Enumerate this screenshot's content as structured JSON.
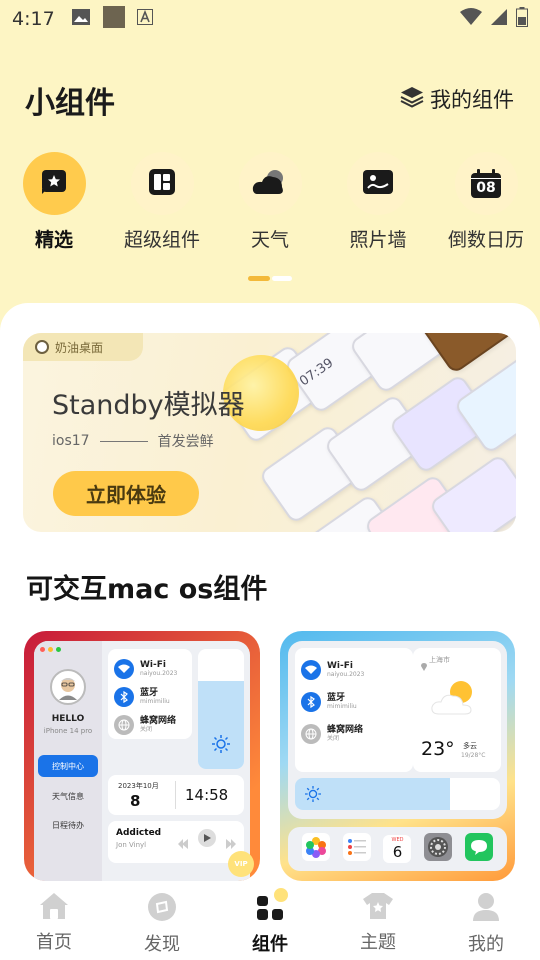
{
  "status_bar": {
    "time": "4:17"
  },
  "header": {
    "title": "小组件",
    "my_widgets_label": "我的组件"
  },
  "categories": [
    {
      "label": "精选",
      "icon": "star-icon",
      "active": true
    },
    {
      "label": "超级组件",
      "icon": "grid-icon",
      "active": false
    },
    {
      "label": "天气",
      "icon": "cloud-icon",
      "active": false
    },
    {
      "label": "照片墙",
      "icon": "photo-icon",
      "active": false
    },
    {
      "label": "倒数日历",
      "icon": "calendar-icon",
      "calendar_day": "08",
      "active": false
    }
  ],
  "banner": {
    "tag": "奶油桌面",
    "title": "Standby模拟器",
    "subtitle_left": "ios17",
    "subtitle_right": "首发尝鲜",
    "button_label": "立即体验",
    "clock_sample": "07:39"
  },
  "section": {
    "title": "可交互mac os组件"
  },
  "widget_left": {
    "profile_name": "HELLO",
    "profile_sub": "iPhone 14 pro",
    "side_active": "控制中心",
    "side_items": [
      "天气信息",
      "日程待办"
    ],
    "wifi_name": "Wi-Fi",
    "wifi_sub": "naiyou.2023",
    "bt_name": "蓝牙",
    "bt_sub": "mimimiliu",
    "cell_name": "蜂窝网络",
    "cell_sub": "关闭",
    "date_label": "2023年10月",
    "date_day": "8",
    "time": "14:58",
    "song": "Addicted",
    "artist": "Jon Vinyl",
    "vip": "VIP"
  },
  "widget_right": {
    "wifi_name": "Wi-Fi",
    "wifi_sub": "naiyou.2023",
    "bt_name": "蓝牙",
    "bt_sub": "mimimiliu",
    "cell_name": "蜂窝网络",
    "cell_sub": "关闭",
    "city": "上海市",
    "temp": "23°",
    "condition": "多云",
    "range": "19/28°C",
    "cal_weekday": "WED",
    "cal_day": "6"
  },
  "bottom_nav": [
    {
      "label": "首页",
      "icon": "home-icon",
      "active": false
    },
    {
      "label": "发现",
      "icon": "discover-icon",
      "active": false
    },
    {
      "label": "组件",
      "icon": "widgets-icon",
      "active": true
    },
    {
      "label": "主题",
      "icon": "theme-shirt-icon",
      "active": false
    },
    {
      "label": "我的",
      "icon": "profile-icon",
      "active": false
    }
  ],
  "colors": {
    "accent": "#ffcb4d",
    "background": "#fdf5c4",
    "blue": "#1a73e8"
  }
}
